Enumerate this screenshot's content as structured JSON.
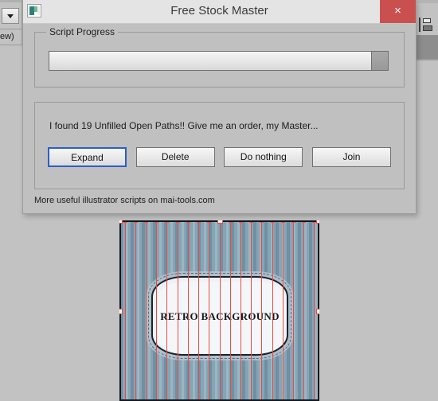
{
  "host_app": {
    "left_panel": {
      "dropdown_icon": "chevron-down-icon",
      "truncated_label": "ew)"
    },
    "right_panel": {
      "align_icon": "align-objects-icon"
    }
  },
  "artwork": {
    "title": "RETRO BACKGROUND",
    "selection": {
      "path_count": 19,
      "anchor_color": "#f2473f",
      "handle_fill": "#ffffff"
    },
    "colors": {
      "stripe_dark": "#6f90a3",
      "stripe_light": "#9ab6c3",
      "frame": "#15181c",
      "cartouche_fill": "#f4f7fa"
    }
  },
  "dialog": {
    "title": "Free Stock Master",
    "app_icon": "app-logo-icon",
    "close_icon": "close-icon",
    "close_label": "×",
    "progress": {
      "legend": "Script Progress",
      "percent": 5
    },
    "message": "I found 19 Unfilled Open Paths!! Give me an order, my Master...",
    "buttons": [
      {
        "label": "Expand",
        "name": "expand-button",
        "default": true
      },
      {
        "label": "Delete",
        "name": "delete-button",
        "default": false
      },
      {
        "label": "Do nothing",
        "name": "do-nothing-button",
        "default": false
      },
      {
        "label": "Join",
        "name": "join-button",
        "default": false
      }
    ],
    "footer": "More useful illustrator scripts on mai-tools.com",
    "accent_colors": {
      "close_button": "#c9504f",
      "default_button_border": "#2a5fc8",
      "titlebar": "#e4e4e4",
      "dialog_face": "#c0c0c0"
    }
  }
}
